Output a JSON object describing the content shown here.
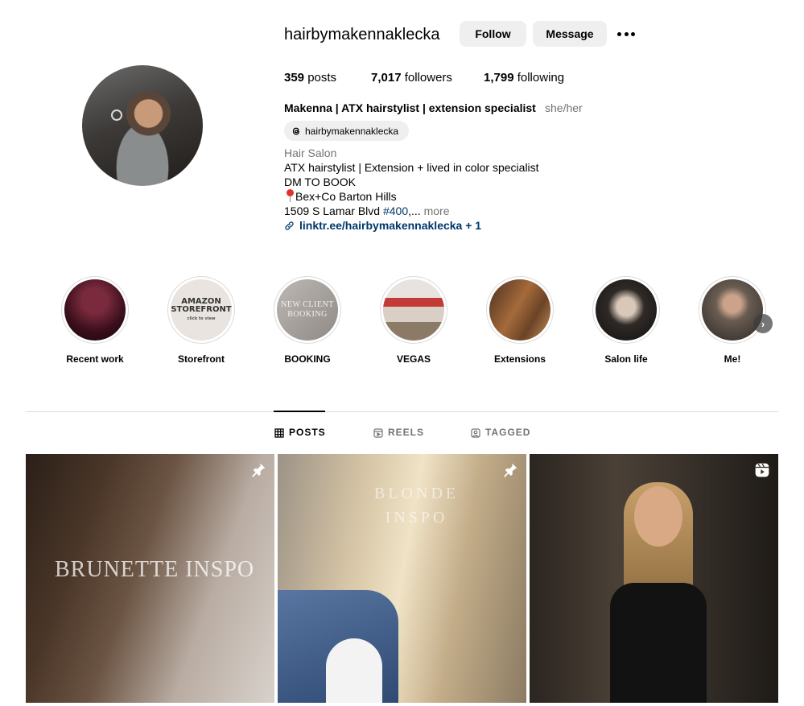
{
  "profile": {
    "username": "hairbymakennaklecka",
    "follow_label": "Follow",
    "message_label": "Message",
    "stats": {
      "posts_count": "359",
      "posts_label": " posts",
      "followers_count": "7,017",
      "followers_label": " followers",
      "following_count": "1,799",
      "following_label": " following"
    },
    "full_name": "Makenna | ATX hairstylist | extension specialist",
    "pronouns": "she/her",
    "threads_handle": "hairbymakennaklecka",
    "category": "Hair Salon",
    "bio": {
      "line1": "ATX hairstylist | Extension + lived in color specialist",
      "line2": "DM TO BOOK",
      "line3": "Bex+Co Barton Hills",
      "line4_prefix": "1509 S Lamar Blvd ",
      "line4_hashtag": "#400",
      "line4_suffix": ",...",
      "more": " more"
    },
    "link": "linktr.ee/hairbymakennaklecka + 1"
  },
  "highlights": [
    {
      "label": "Recent work"
    },
    {
      "label": "Storefront",
      "cover_title": "AMAZON STOREFRONT",
      "cover_sub": "click to view"
    },
    {
      "label": "BOOKING",
      "cover_title": "NEW CLIENT BOOKING"
    },
    {
      "label": "VEGAS"
    },
    {
      "label": "Extensions"
    },
    {
      "label": "Salon life"
    },
    {
      "label": "Me!"
    }
  ],
  "tabs": {
    "posts": "POSTS",
    "reels": "REELS",
    "tagged": "TAGGED"
  },
  "posts": [
    {
      "overlay_text": "BRUNETTE INSPO",
      "badge": "pin-icon"
    },
    {
      "overlay_line1": "BLONDE",
      "overlay_line2": "INSPO",
      "badge": "pin-icon"
    },
    {
      "badge": "reel-icon"
    }
  ]
}
